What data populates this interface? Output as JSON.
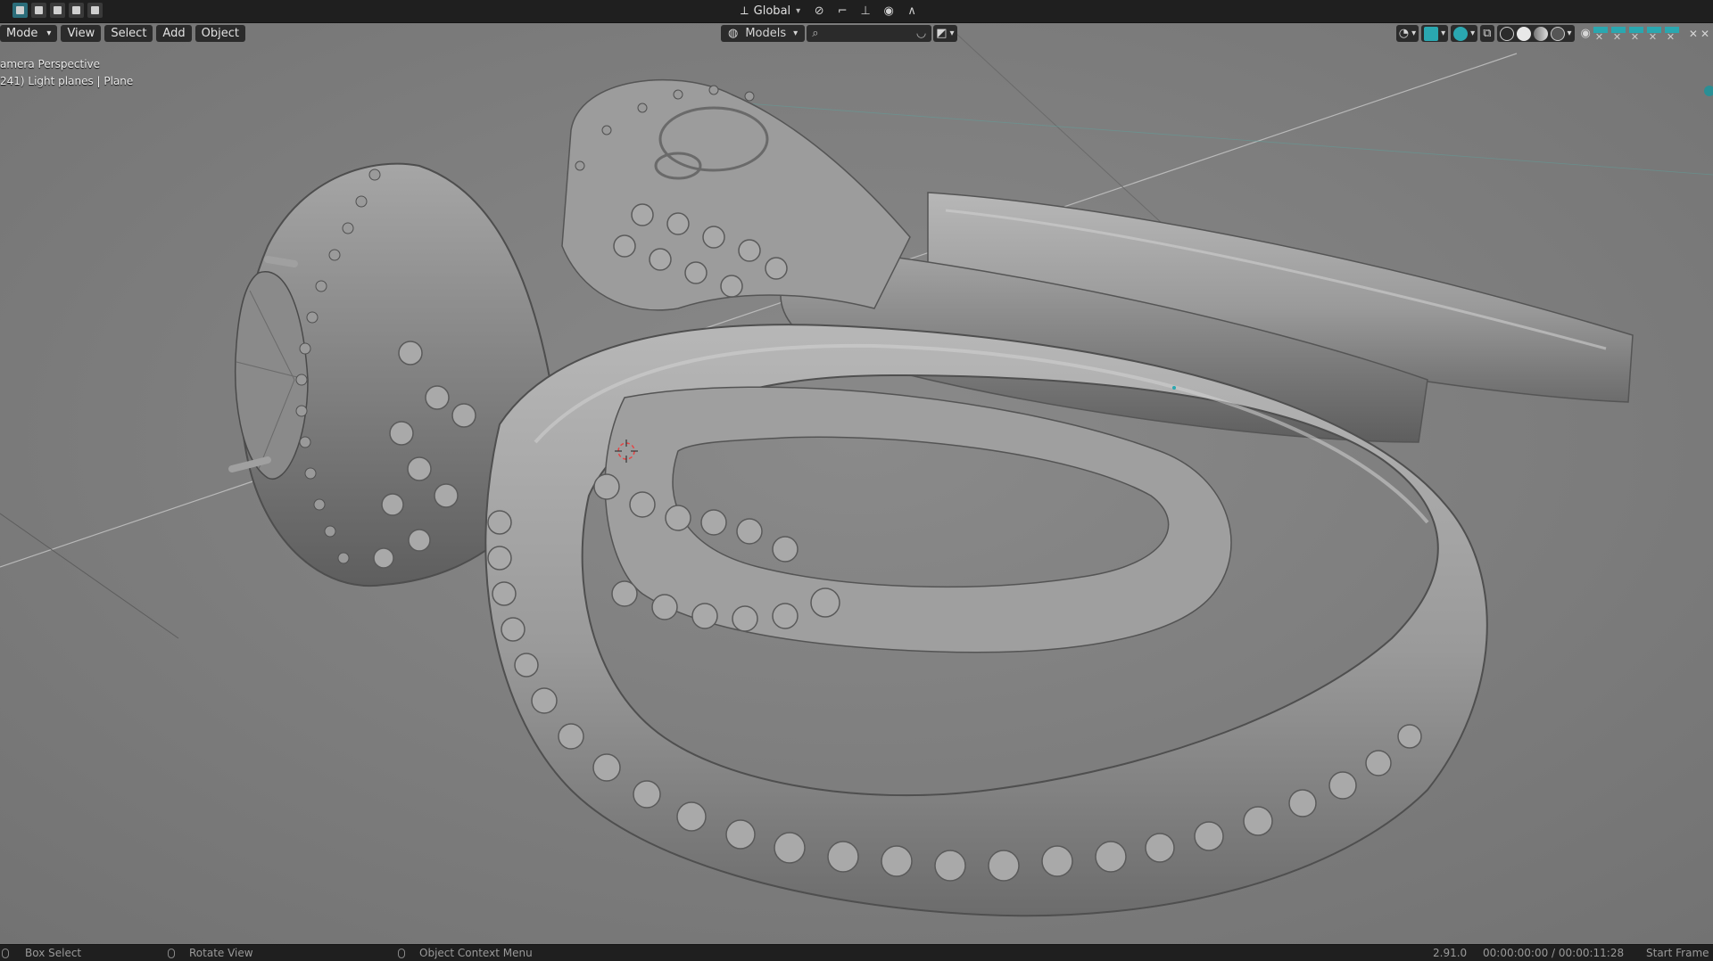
{
  "topbar": {
    "select_modes": [
      "box-select",
      "extend",
      "subtract",
      "difference",
      "intersect"
    ],
    "orientation_label": "Global",
    "active_mode_color": "#2b6d7a"
  },
  "viewport_header": {
    "mode_label": "Mode",
    "menus": [
      "View",
      "Select",
      "Add",
      "Object"
    ],
    "collection_label": "Models"
  },
  "overlay": {
    "line1": "amera Perspective",
    "line2": "241) Light planes | Plane"
  },
  "status": {
    "left_action": "Box Select",
    "middle_action": "Rotate View",
    "right_action": "Object Context Menu",
    "version": "2.91.0",
    "timecode": "00:00:00:00 / 00:00:11:28",
    "frame_label": "Start Frame"
  },
  "colors": {
    "viewport_bg": "#7d7d7d",
    "accent": "#2aa7b0",
    "header_bg": "#1f1f1f"
  }
}
